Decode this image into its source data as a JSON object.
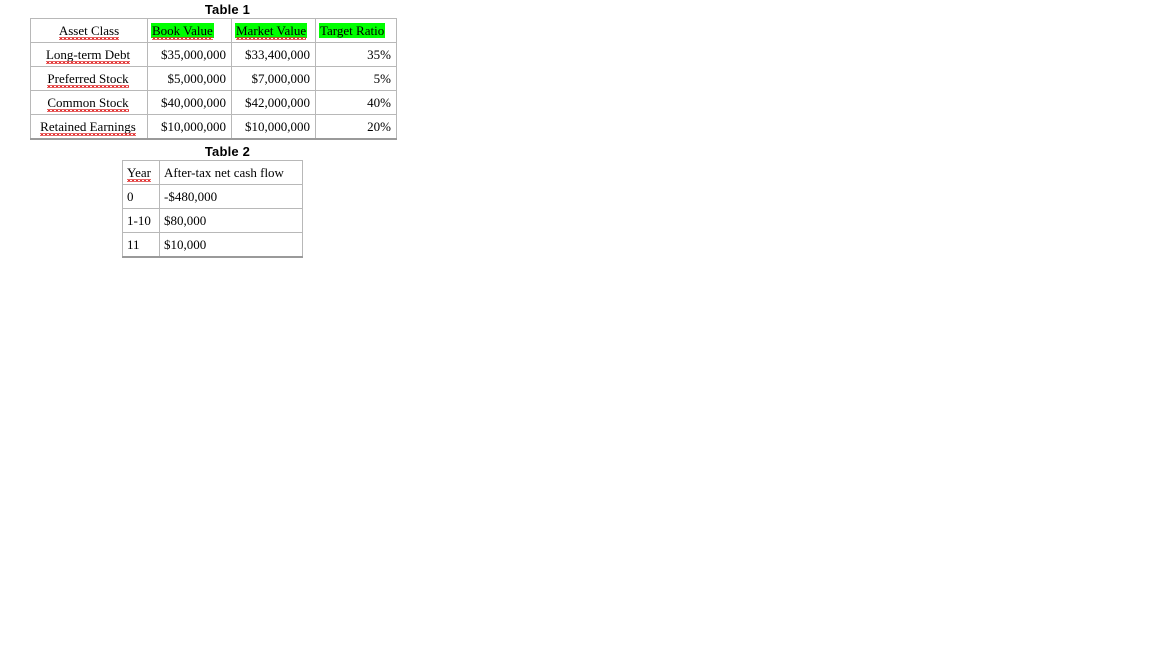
{
  "document": {
    "background_color": "#ffffff",
    "highlight_color": "#00ff00",
    "spellcheck_underline_color": "#e03030",
    "border_color": "#b8b8b8"
  },
  "table_1": {
    "caption": "Table 1",
    "headers": [
      {
        "label": "Asset Class",
        "highlighted": false,
        "align": "center",
        "spellcheck": true
      },
      {
        "label": "Book Value",
        "highlighted": true,
        "align": "left",
        "spellcheck": true
      },
      {
        "label": "Market Value",
        "highlighted": true,
        "align": "left",
        "spellcheck": true
      },
      {
        "label": "Target Ratio",
        "highlighted": true,
        "align": "left",
        "spellcheck": false
      }
    ],
    "rows": [
      {
        "asset_class": "Long-term Debt",
        "book_value": "$35,000,000",
        "market_value": "$33,400,000",
        "target_ratio": "35%"
      },
      {
        "asset_class": "Preferred Stock",
        "book_value": "$5,000,000",
        "market_value": "$7,000,000",
        "target_ratio": "5%"
      },
      {
        "asset_class": "Common Stock",
        "book_value": "$40,000,000",
        "market_value": "$42,000,000",
        "target_ratio": "40%"
      },
      {
        "asset_class": "Retained Earnings",
        "book_value": "$10,000,000",
        "market_value": "$10,000,000",
        "target_ratio": "20%"
      }
    ]
  },
  "table_2": {
    "caption": "Table 2",
    "headers": [
      {
        "label": "Year",
        "spellcheck": true
      },
      {
        "label": "After-tax net cash flow",
        "spellcheck": false
      }
    ],
    "rows": [
      {
        "year": "0",
        "cash_flow": "-$480,000"
      },
      {
        "year": "1-10",
        "cash_flow": "$80,000"
      },
      {
        "year": "11",
        "cash_flow": "$10,000"
      }
    ]
  }
}
